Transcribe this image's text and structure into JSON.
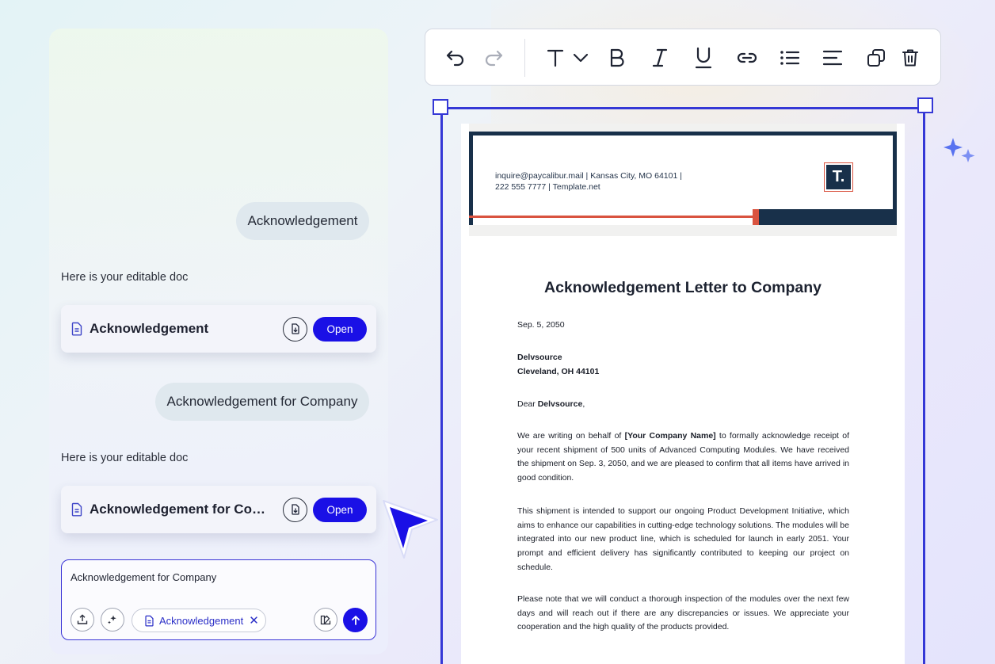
{
  "chat": {
    "messages": [
      {
        "role": "user",
        "text": "Acknowledgement"
      },
      {
        "role": "assistant",
        "text": "Here is your editable doc",
        "doc_title": "Acknowledgement",
        "open_label": "Open"
      },
      {
        "role": "user",
        "text": "Acknowledgement for Company"
      },
      {
        "role": "assistant",
        "text": "Here is your editable doc",
        "doc_title": "Acknowledgement for Comp...",
        "open_label": "Open"
      }
    ],
    "composer": {
      "input_value": "Acknowledgement for Company",
      "attachment_chip": "Acknowledgement",
      "chip_remove_glyph": "✕"
    }
  },
  "toolbar": {
    "icons": [
      "undo-icon",
      "redo-icon",
      "text-style-icon",
      "chevron-down-icon",
      "bold-icon",
      "italic-icon",
      "underline-icon",
      "link-icon",
      "bullet-list-icon",
      "align-left-icon",
      "duplicate-icon",
      "delete-icon"
    ],
    "accent": "#1a10e6"
  },
  "document": {
    "contact_line_1": "inquire@paycalibur.mail | Kansas City, MO 64101 |",
    "contact_line_2": "222 555 7777 | Template.net",
    "logo_text": "T.",
    "title": "Acknowledgement Letter to Company",
    "date": "Sep. 5, 2050",
    "recipient_name": "Delvsource",
    "recipient_address": "Cleveland, OH 44101",
    "salutation_prefix": "Dear ",
    "salutation_name": "Delvsource",
    "salutation_suffix": ",",
    "p1_before": "We are writing on behalf of ",
    "p1_bold": "[Your Company Name]",
    "p1_after": " to formally acknowledge receipt of your recent shipment of 500 units of Advanced Computing Modules. We have received the shipment on Sep. 3, 2050, and we are pleased to confirm that all items have arrived in good condition.",
    "p2": "This shipment is intended to support our ongoing Product Development Initiative, which aims to enhance our capabilities in cutting-edge technology solutions. The modules will be integrated into our new product line, which is scheduled for launch in early 2051. Your prompt and efficient delivery has significantly contributed to keeping our project on schedule.",
    "p3": "Please note that we will conduct a thorough inspection of the modules over the next few days and will reach out if there are any discrepancies or issues. We appreciate your cooperation and the high quality of the products provided.",
    "colors": {
      "navy": "#18304a",
      "red": "#d9533f",
      "selection": "#3538d6"
    }
  }
}
